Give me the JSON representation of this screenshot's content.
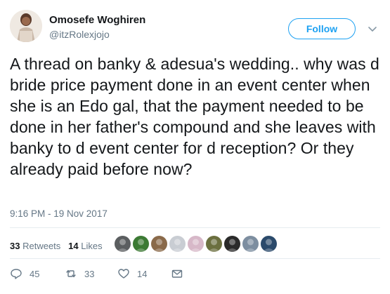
{
  "author": {
    "name": "Omosefe Woghiren",
    "handle": "@itzRolexjojo"
  },
  "follow_label": "Follow",
  "tweet": {
    "text": "A thread on banky & adesua's wedding.. why was d bride price payment done in an event center when she is an Edo gal, that the payment needed to be done in her father's compound and she leaves with banky to d event center for d reception? Or they already paid before now?",
    "timestamp": "9:16 PM - 19 Nov 2017"
  },
  "stats": {
    "retweets_count": "33",
    "retweets_label": "Retweets",
    "likes_count": "14",
    "likes_label": "Likes"
  },
  "likers": [
    {
      "name": "liker-avatar-1",
      "color": "#5b5e60"
    },
    {
      "name": "liker-avatar-2",
      "color": "#3c7a34"
    },
    {
      "name": "liker-avatar-3",
      "color": "#8a6a4a"
    },
    {
      "name": "liker-avatar-4",
      "color": "#c9cdd3"
    },
    {
      "name": "liker-avatar-5",
      "color": "#d7b8c8"
    },
    {
      "name": "liker-avatar-6",
      "color": "#6b6f3f"
    },
    {
      "name": "liker-avatar-7",
      "color": "#2a2a2a"
    },
    {
      "name": "liker-avatar-8",
      "color": "#7d8ea0"
    },
    {
      "name": "liker-avatar-9",
      "color": "#2b4a6b"
    }
  ],
  "actions": {
    "reply_count": "45",
    "retweet_count": "33",
    "like_count": "14"
  },
  "colors": {
    "accent": "#1da1f2",
    "muted": "#657786",
    "text": "#14171a"
  }
}
